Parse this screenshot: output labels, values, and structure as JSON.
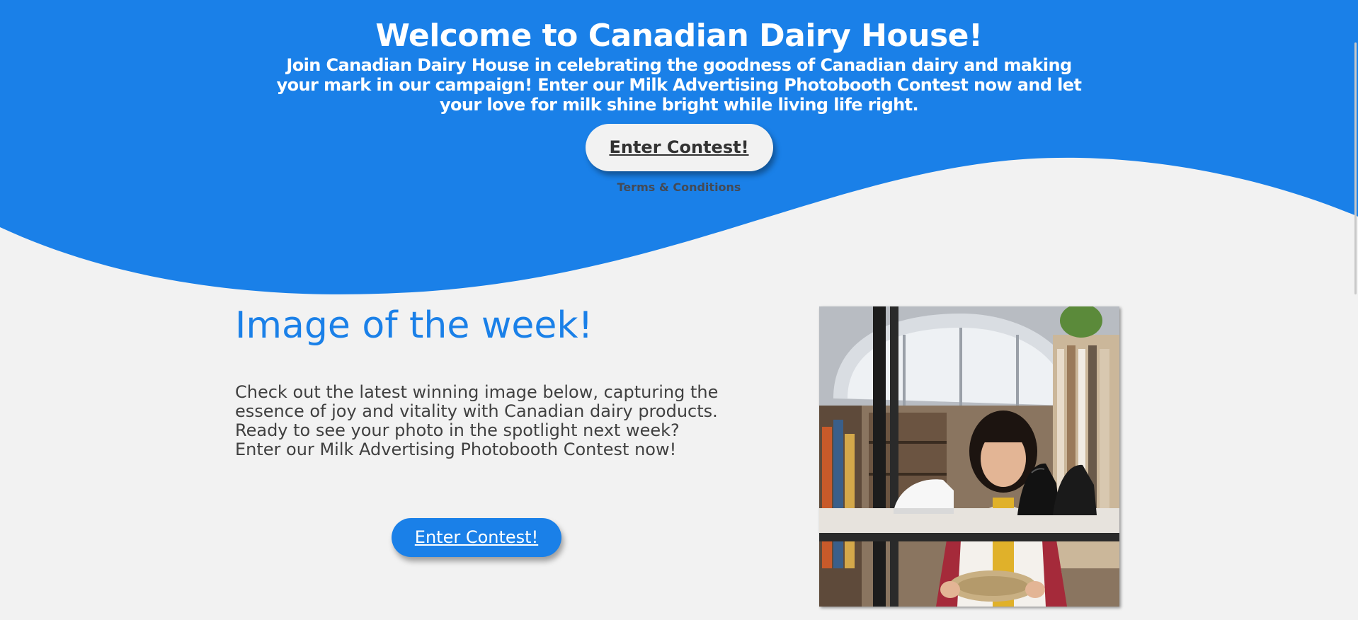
{
  "hero": {
    "title": "Welcome to Canadian Dairy House!",
    "subtitle": "Join Canadian Dairy House in celebrating the goodness of Canadian dairy and making your mark in our campaign! Enter our Milk Advertising Photobooth Contest now and let your love for milk shine bright while living life right.",
    "cta_label": "Enter Contest!",
    "terms_label": "Terms & Conditions"
  },
  "week": {
    "title": "Image of the week!",
    "text": "Check out the latest winning image below, capturing the essence of joy and vitality with Canadian dairy products. Ready to see your photo in the spotlight next week? Enter our Milk Advertising Photobooth Contest now!",
    "cta_label": "Enter Contest!",
    "image_subject": "woman-examining-shoes-photo"
  },
  "colors": {
    "brand_blue": "#1a80e8",
    "background": "#f2f2f2",
    "body_text": "#404040"
  }
}
